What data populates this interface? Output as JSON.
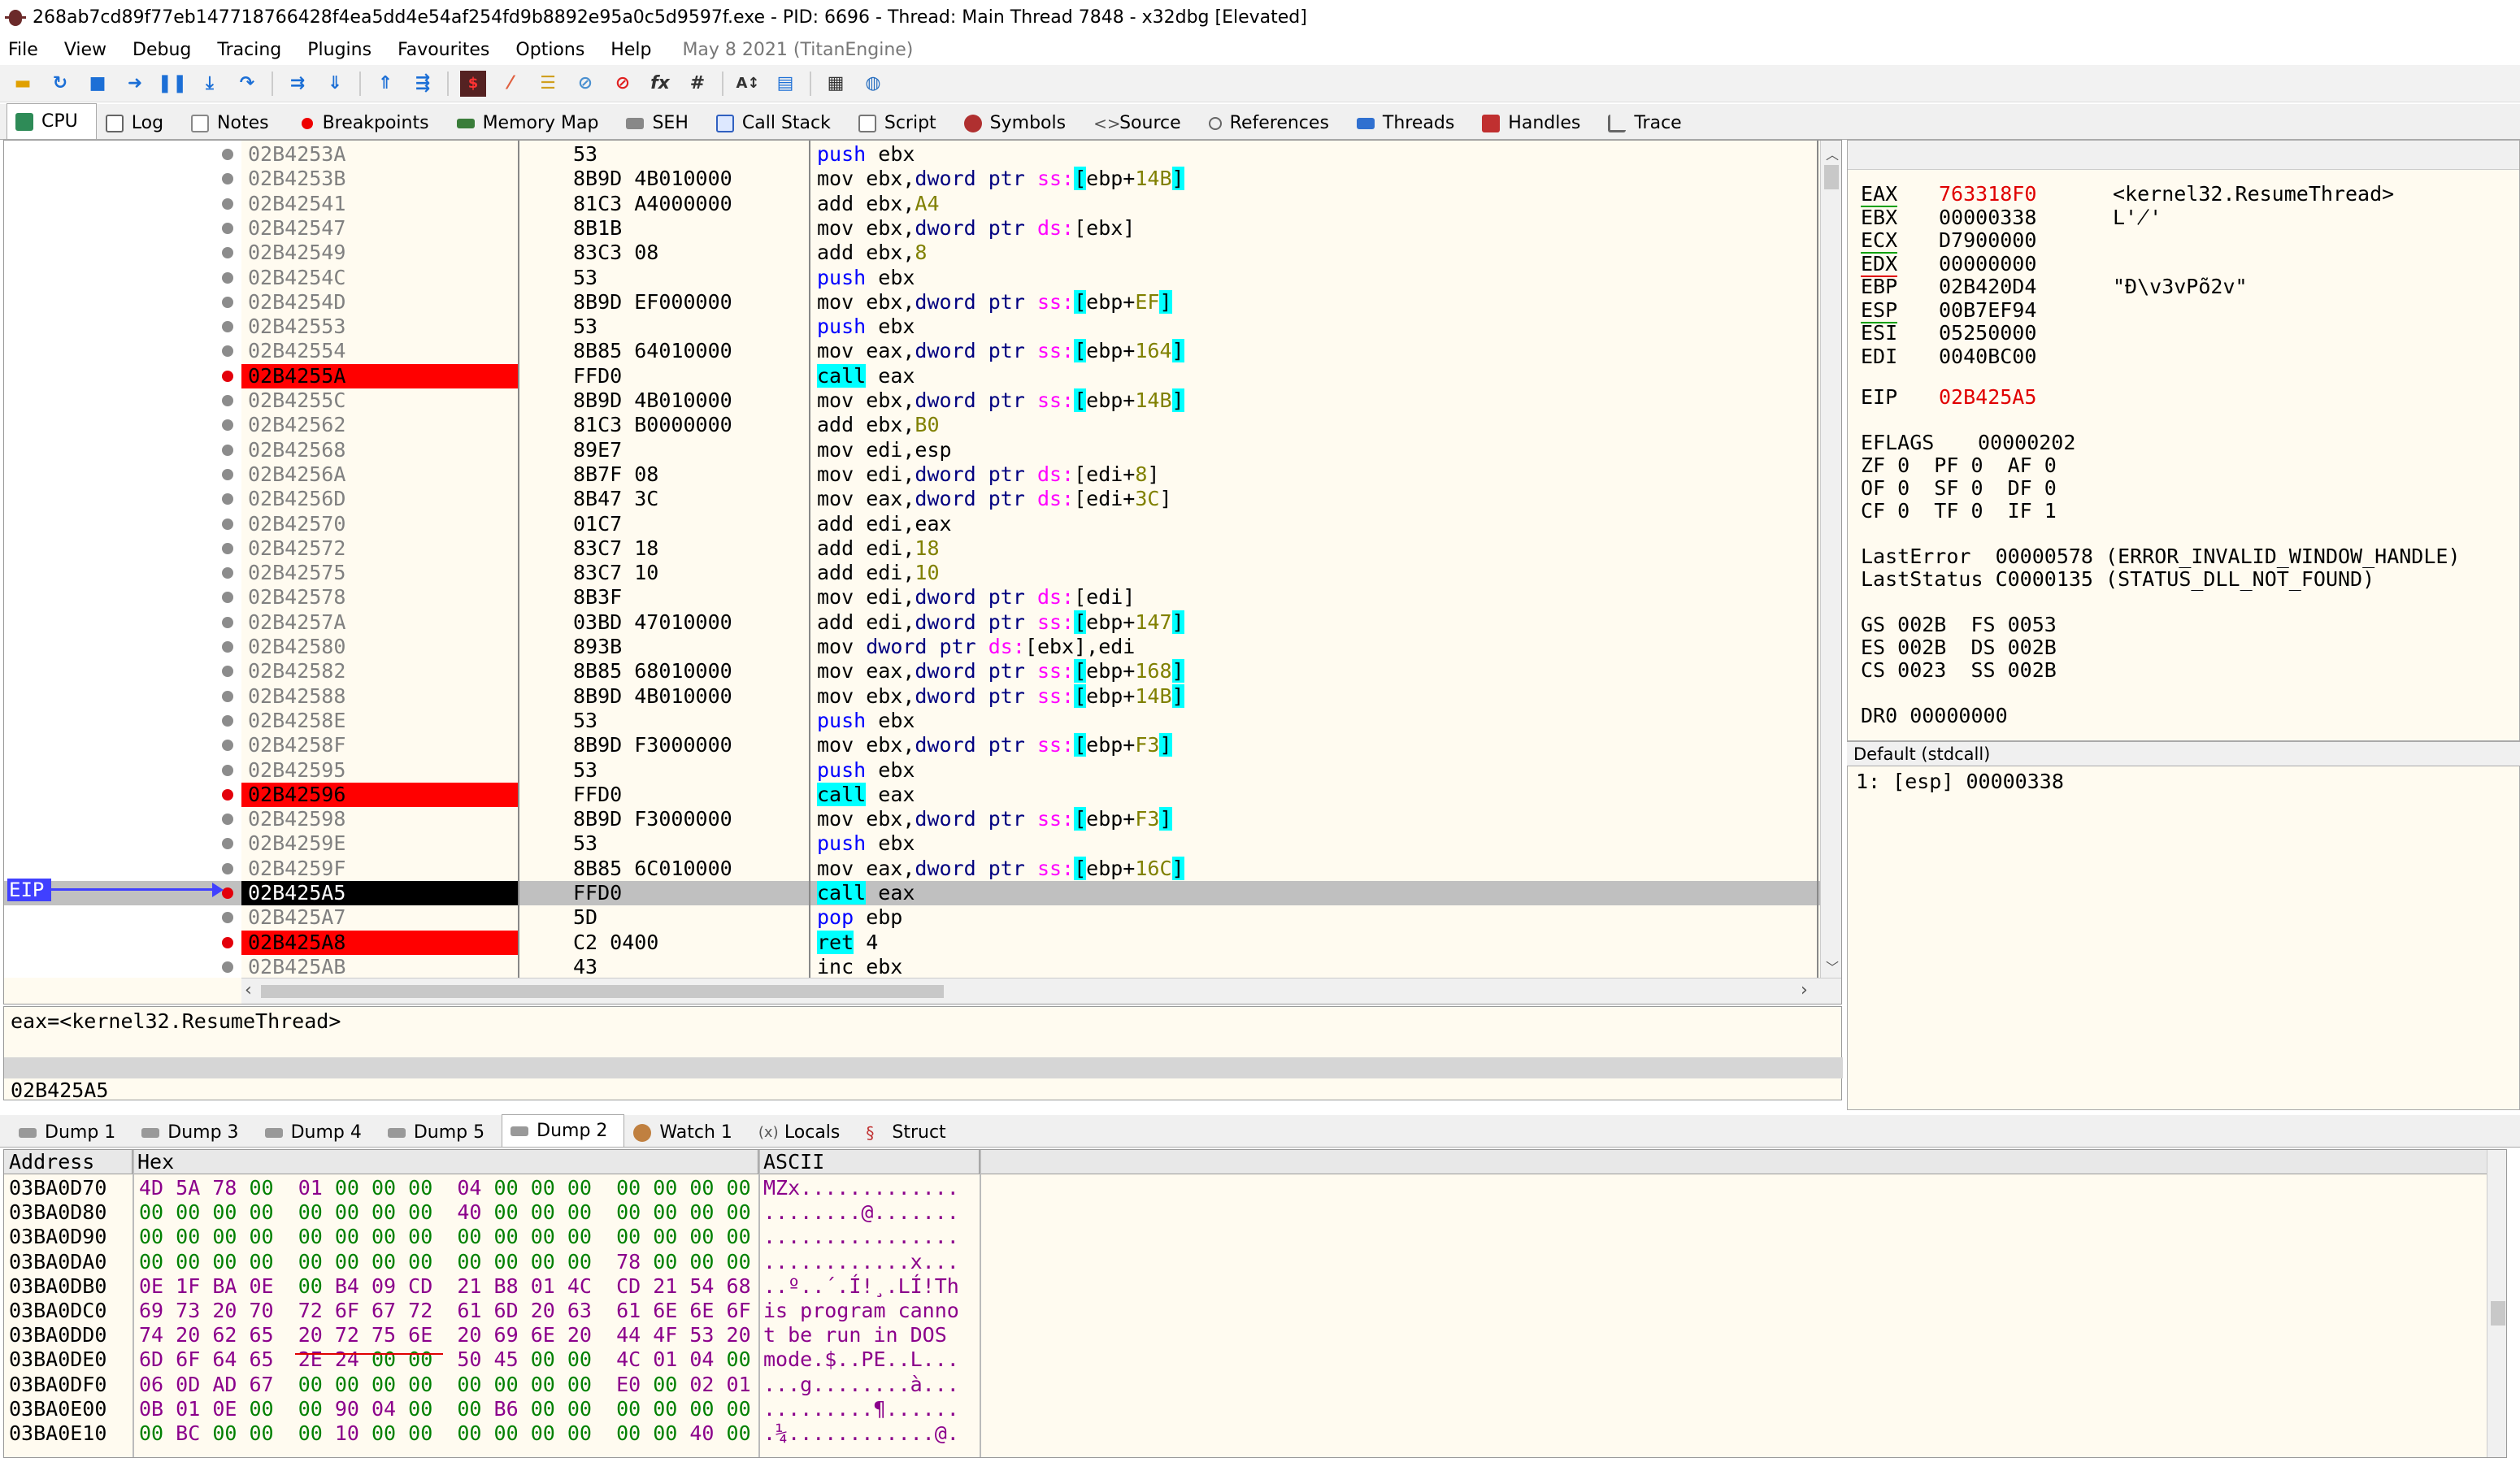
{
  "window": {
    "title": "268ab7cd89f77eb147718766428f4ea5dd4e54af254fd9b8892e95a0c5d9597f.exe - PID: 6696 - Thread: Main Thread 7848 - x32dbg [Elevated]"
  },
  "menu": {
    "items": [
      "File",
      "View",
      "Debug",
      "Tracing",
      "Plugins",
      "Favourites",
      "Options",
      "Help"
    ],
    "date": "May 8 2021 (TitanEngine)"
  },
  "toolbar": {
    "icons": [
      "open-icon",
      "restart-icon",
      "close-icon",
      "run-icon",
      "pause-icon",
      "step-into-icon",
      "step-over-icon",
      "trace-into-icon",
      "trace-over-icon",
      "execute-till-return-icon",
      "run-to-user-code-icon",
      "scylla-icon",
      "patch-icon",
      "comment-icon",
      "label-icon",
      "bookmark-icon",
      "function-icon",
      "hash-icon",
      "font-icon",
      "favourites-icon",
      "calculator-icon",
      "help-icon"
    ]
  },
  "tabs": [
    {
      "label": "CPU",
      "icon": "cpu-icon"
    },
    {
      "label": "Log",
      "icon": "log-icon"
    },
    {
      "label": "Notes",
      "icon": "notes-icon"
    },
    {
      "label": "Breakpoints",
      "icon": "breakpoint-icon"
    },
    {
      "label": "Memory Map",
      "icon": "memory-icon"
    },
    {
      "label": "SEH",
      "icon": "seh-icon"
    },
    {
      "label": "Call Stack",
      "icon": "callstack-icon"
    },
    {
      "label": "Script",
      "icon": "script-icon"
    },
    {
      "label": "Symbols",
      "icon": "symbols-icon"
    },
    {
      "label": "Source",
      "icon": "source-icon"
    },
    {
      "label": "References",
      "icon": "references-icon"
    },
    {
      "label": "Threads",
      "icon": "threads-icon"
    },
    {
      "label": "Handles",
      "icon": "handles-icon"
    },
    {
      "label": "Trace",
      "icon": "trace-icon"
    }
  ],
  "eip_label": "EIP",
  "disasm": [
    {
      "addr": "02B4253A",
      "bytes": "53",
      "ins": [
        [
          "push",
          "push"
        ],
        [
          "t",
          " ebx"
        ]
      ],
      "state": ""
    },
    {
      "addr": "02B4253B",
      "bytes": "8B9D 4B010000",
      "ins": [
        [
          "mov",
          "mov"
        ],
        [
          "t",
          " ebx,"
        ],
        [
          "ptr",
          "dword ptr "
        ],
        [
          "seg",
          "ss:"
        ],
        [
          "br",
          "["
        ],
        [
          "t",
          "ebp+"
        ],
        [
          "num",
          "14B"
        ],
        [
          "br",
          "]"
        ]
      ],
      "state": ""
    },
    {
      "addr": "02B42541",
      "bytes": "81C3 A4000000",
      "ins": [
        [
          "add",
          "add"
        ],
        [
          "t",
          " ebx,"
        ],
        [
          "num",
          "A4"
        ]
      ],
      "state": ""
    },
    {
      "addr": "02B42547",
      "bytes": "8B1B",
      "ins": [
        [
          "mov",
          "mov"
        ],
        [
          "t",
          " ebx,"
        ],
        [
          "ptr",
          "dword ptr "
        ],
        [
          "seg",
          "ds:"
        ],
        [
          "t",
          "[ebx]"
        ]
      ],
      "state": ""
    },
    {
      "addr": "02B42549",
      "bytes": "83C3 08",
      "ins": [
        [
          "add",
          "add"
        ],
        [
          "t",
          " ebx,"
        ],
        [
          "num",
          "8"
        ]
      ],
      "state": ""
    },
    {
      "addr": "02B4254C",
      "bytes": "53",
      "ins": [
        [
          "push",
          "push"
        ],
        [
          "t",
          " ebx"
        ]
      ],
      "state": ""
    },
    {
      "addr": "02B4254D",
      "bytes": "8B9D EF000000",
      "ins": [
        [
          "mov",
          "mov"
        ],
        [
          "t",
          " ebx,"
        ],
        [
          "ptr",
          "dword ptr "
        ],
        [
          "seg",
          "ss:"
        ],
        [
          "br",
          "["
        ],
        [
          "t",
          "ebp+"
        ],
        [
          "num",
          "EF"
        ],
        [
          "br",
          "]"
        ]
      ],
      "state": ""
    },
    {
      "addr": "02B42553",
      "bytes": "53",
      "ins": [
        [
          "push",
          "push"
        ],
        [
          "t",
          " ebx"
        ]
      ],
      "state": ""
    },
    {
      "addr": "02B42554",
      "bytes": "8B85 64010000",
      "ins": [
        [
          "mov",
          "mov"
        ],
        [
          "t",
          " eax,"
        ],
        [
          "ptr",
          "dword ptr "
        ],
        [
          "seg",
          "ss:"
        ],
        [
          "br",
          "["
        ],
        [
          "t",
          "ebp+"
        ],
        [
          "num",
          "164"
        ],
        [
          "br",
          "]"
        ]
      ],
      "state": ""
    },
    {
      "addr": "02B4255A",
      "bytes": "FFD0",
      "ins": [
        [
          "call",
          "call"
        ],
        [
          "t",
          " eax"
        ]
      ],
      "state": "bp"
    },
    {
      "addr": "02B4255C",
      "bytes": "8B9D 4B010000",
      "ins": [
        [
          "mov",
          "mov"
        ],
        [
          "t",
          " ebx,"
        ],
        [
          "ptr",
          "dword ptr "
        ],
        [
          "seg",
          "ss:"
        ],
        [
          "br",
          "["
        ],
        [
          "t",
          "ebp+"
        ],
        [
          "num",
          "14B"
        ],
        [
          "br",
          "]"
        ]
      ],
      "state": ""
    },
    {
      "addr": "02B42562",
      "bytes": "81C3 B0000000",
      "ins": [
        [
          "add",
          "add"
        ],
        [
          "t",
          " ebx,"
        ],
        [
          "num",
          "B0"
        ]
      ],
      "state": ""
    },
    {
      "addr": "02B42568",
      "bytes": "89E7",
      "ins": [
        [
          "mov",
          "mov"
        ],
        [
          "t",
          " edi,esp"
        ]
      ],
      "state": ""
    },
    {
      "addr": "02B4256A",
      "bytes": "8B7F 08",
      "ins": [
        [
          "mov",
          "mov"
        ],
        [
          "t",
          " edi,"
        ],
        [
          "ptr",
          "dword ptr "
        ],
        [
          "seg",
          "ds:"
        ],
        [
          "t",
          "[edi+"
        ],
        [
          "num",
          "8"
        ],
        [
          "t",
          "]"
        ]
      ],
      "state": ""
    },
    {
      "addr": "02B4256D",
      "bytes": "8B47 3C",
      "ins": [
        [
          "mov",
          "mov"
        ],
        [
          "t",
          " eax,"
        ],
        [
          "ptr",
          "dword ptr "
        ],
        [
          "seg",
          "ds:"
        ],
        [
          "t",
          "[edi+"
        ],
        [
          "num",
          "3C"
        ],
        [
          "t",
          "]"
        ]
      ],
      "state": ""
    },
    {
      "addr": "02B42570",
      "bytes": "01C7",
      "ins": [
        [
          "add",
          "add"
        ],
        [
          "t",
          " edi,eax"
        ]
      ],
      "state": ""
    },
    {
      "addr": "02B42572",
      "bytes": "83C7 18",
      "ins": [
        [
          "add",
          "add"
        ],
        [
          "t",
          " edi,"
        ],
        [
          "num",
          "18"
        ]
      ],
      "state": ""
    },
    {
      "addr": "02B42575",
      "bytes": "83C7 10",
      "ins": [
        [
          "add",
          "add"
        ],
        [
          "t",
          " edi,"
        ],
        [
          "num",
          "10"
        ]
      ],
      "state": ""
    },
    {
      "addr": "02B42578",
      "bytes": "8B3F",
      "ins": [
        [
          "mov",
          "mov"
        ],
        [
          "t",
          " edi,"
        ],
        [
          "ptr",
          "dword ptr "
        ],
        [
          "seg",
          "ds:"
        ],
        [
          "t",
          "[edi]"
        ]
      ],
      "state": ""
    },
    {
      "addr": "02B4257A",
      "bytes": "03BD 47010000",
      "ins": [
        [
          "add",
          "add"
        ],
        [
          "t",
          " edi,"
        ],
        [
          "ptr",
          "dword ptr "
        ],
        [
          "seg",
          "ss:"
        ],
        [
          "br",
          "["
        ],
        [
          "t",
          "ebp+"
        ],
        [
          "num",
          "147"
        ],
        [
          "br",
          "]"
        ]
      ],
      "state": ""
    },
    {
      "addr": "02B42580",
      "bytes": "893B",
      "ins": [
        [
          "mov",
          "mov"
        ],
        [
          "t",
          " "
        ],
        [
          "ptr",
          "dword ptr "
        ],
        [
          "seg",
          "ds:"
        ],
        [
          "t",
          "[ebx],edi"
        ]
      ],
      "state": ""
    },
    {
      "addr": "02B42582",
      "bytes": "8B85 68010000",
      "ins": [
        [
          "mov",
          "mov"
        ],
        [
          "t",
          " eax,"
        ],
        [
          "ptr",
          "dword ptr "
        ],
        [
          "seg",
          "ss:"
        ],
        [
          "br",
          "["
        ],
        [
          "t",
          "ebp+"
        ],
        [
          "num",
          "168"
        ],
        [
          "br",
          "]"
        ]
      ],
      "state": ""
    },
    {
      "addr": "02B42588",
      "bytes": "8B9D 4B010000",
      "ins": [
        [
          "mov",
          "mov"
        ],
        [
          "t",
          " ebx,"
        ],
        [
          "ptr",
          "dword ptr "
        ],
        [
          "seg",
          "ss:"
        ],
        [
          "br",
          "["
        ],
        [
          "t",
          "ebp+"
        ],
        [
          "num",
          "14B"
        ],
        [
          "br",
          "]"
        ]
      ],
      "state": ""
    },
    {
      "addr": "02B4258E",
      "bytes": "53",
      "ins": [
        [
          "push",
          "push"
        ],
        [
          "t",
          " ebx"
        ]
      ],
      "state": ""
    },
    {
      "addr": "02B4258F",
      "bytes": "8B9D F3000000",
      "ins": [
        [
          "mov",
          "mov"
        ],
        [
          "t",
          " ebx,"
        ],
        [
          "ptr",
          "dword ptr "
        ],
        [
          "seg",
          "ss:"
        ],
        [
          "br",
          "["
        ],
        [
          "t",
          "ebp+"
        ],
        [
          "num",
          "F3"
        ],
        [
          "br",
          "]"
        ]
      ],
      "state": ""
    },
    {
      "addr": "02B42595",
      "bytes": "53",
      "ins": [
        [
          "push",
          "push"
        ],
        [
          "t",
          " ebx"
        ]
      ],
      "state": ""
    },
    {
      "addr": "02B42596",
      "bytes": "FFD0",
      "ins": [
        [
          "call",
          "call"
        ],
        [
          "t",
          " eax"
        ]
      ],
      "state": "bp"
    },
    {
      "addr": "02B42598",
      "bytes": "8B9D F3000000",
      "ins": [
        [
          "mov",
          "mov"
        ],
        [
          "t",
          " ebx,"
        ],
        [
          "ptr",
          "dword ptr "
        ],
        [
          "seg",
          "ss:"
        ],
        [
          "br",
          "["
        ],
        [
          "t",
          "ebp+"
        ],
        [
          "num",
          "F3"
        ],
        [
          "br",
          "]"
        ]
      ],
      "state": ""
    },
    {
      "addr": "02B4259E",
      "bytes": "53",
      "ins": [
        [
          "push",
          "push"
        ],
        [
          "t",
          " ebx"
        ]
      ],
      "state": ""
    },
    {
      "addr": "02B4259F",
      "bytes": "8B85 6C010000",
      "ins": [
        [
          "mov",
          "mov"
        ],
        [
          "t",
          " eax,"
        ],
        [
          "ptr",
          "dword ptr "
        ],
        [
          "seg",
          "ss:"
        ],
        [
          "br",
          "["
        ],
        [
          "t",
          "ebp+"
        ],
        [
          "num",
          "16C"
        ],
        [
          "br",
          "]"
        ]
      ],
      "state": ""
    },
    {
      "addr": "02B425A5",
      "bytes": "FFD0",
      "ins": [
        [
          "call",
          "call"
        ],
        [
          "t",
          " eax"
        ]
      ],
      "state": "eip"
    },
    {
      "addr": "02B425A7",
      "bytes": "5D",
      "ins": [
        [
          "pop",
          "pop"
        ],
        [
          "t",
          " ebp"
        ]
      ],
      "state": ""
    },
    {
      "addr": "02B425A8",
      "bytes": "C2 0400",
      "ins": [
        [
          "call",
          "ret"
        ],
        [
          "t",
          " 4"
        ]
      ],
      "state": "bp"
    },
    {
      "addr": "02B425AB",
      "bytes": "43",
      "ins": [
        [
          "inc",
          "inc"
        ],
        [
          "t",
          " ebx"
        ]
      ],
      "state": ""
    }
  ],
  "info": {
    "line1": "eax=<kernel32.ResumeThread>",
    "line2": "02B425A5"
  },
  "registers": {
    "gp": [
      {
        "name": "EAX",
        "value": "763318F0",
        "comment": "<kernel32.ResumeThread>",
        "changed": true
      },
      {
        "name": "EBX",
        "value": "00000338",
        "comment": "L'̸'",
        "changed": false
      },
      {
        "name": "ECX",
        "value": "D7900000",
        "comment": "",
        "changed": false
      },
      {
        "name": "EDX",
        "value": "00000000",
        "comment": "",
        "changed": false
      },
      {
        "name": "EBP",
        "value": "02B420D4",
        "comment": "\"Ð\\v3vPõ2v\"",
        "changed": false
      },
      {
        "name": "ESP",
        "value": "00B7EF94",
        "comment": "",
        "changed": false
      },
      {
        "name": "ESI",
        "value": "05250000",
        "comment": "",
        "changed": false
      },
      {
        "name": "EDI",
        "value": "0040BC00",
        "comment": "",
        "changed": false
      }
    ],
    "eip": {
      "name": "EIP",
      "value": "02B425A5"
    },
    "eflags": {
      "name": "EFLAGS",
      "value": "00000202"
    },
    "flags": [
      "ZF 0  PF 0  AF 0",
      "OF 0  SF 0  DF 0",
      "CF 0  TF 0  IF 1"
    ],
    "lasterror": "LastError  00000578 (ERROR_INVALID_WINDOW_HANDLE)",
    "laststatus": "LastStatus C0000135 (STATUS_DLL_NOT_FOUND)",
    "segs": [
      "GS 002B  FS 0053",
      "ES 002B  DS 002B",
      "CS 0023  SS 002B"
    ],
    "dr0": "DR0 00000000"
  },
  "stack": {
    "header": "Default (stdcall)",
    "line": "1: [esp] 00000338"
  },
  "dumptabs": [
    {
      "label": "Dump 1"
    },
    {
      "label": "Dump 3"
    },
    {
      "label": "Dump 4"
    },
    {
      "label": "Dump 5"
    },
    {
      "label": "Dump 2"
    },
    {
      "label": "Watch 1"
    },
    {
      "label": "Locals"
    },
    {
      "label": "Struct"
    }
  ],
  "dump": {
    "headers": [
      "Address",
      "Hex",
      "ASCII"
    ],
    "rows": [
      {
        "addr": "03BA0D70",
        "hex": [
          "4D",
          "5A",
          "78",
          "00",
          "01",
          "00",
          "00",
          "00",
          "04",
          "00",
          "00",
          "00",
          "00",
          "00",
          "00",
          "00"
        ],
        "ascii": "MZx............."
      },
      {
        "addr": "03BA0D80",
        "hex": [
          "00",
          "00",
          "00",
          "00",
          "00",
          "00",
          "00",
          "00",
          "40",
          "00",
          "00",
          "00",
          "00",
          "00",
          "00",
          "00"
        ],
        "ascii": "........@......."
      },
      {
        "addr": "03BA0D90",
        "hex": [
          "00",
          "00",
          "00",
          "00",
          "00",
          "00",
          "00",
          "00",
          "00",
          "00",
          "00",
          "00",
          "00",
          "00",
          "00",
          "00"
        ],
        "ascii": "................"
      },
      {
        "addr": "03BA0DA0",
        "hex": [
          "00",
          "00",
          "00",
          "00",
          "00",
          "00",
          "00",
          "00",
          "00",
          "00",
          "00",
          "00",
          "78",
          "00",
          "00",
          "00"
        ],
        "ascii": "............x..."
      },
      {
        "addr": "03BA0DB0",
        "hex": [
          "0E",
          "1F",
          "BA",
          "0E",
          "00",
          "B4",
          "09",
          "CD",
          "21",
          "B8",
          "01",
          "4C",
          "CD",
          "21",
          "54",
          "68"
        ],
        "ascii": "..º..´.Í!¸.LÍ!Th"
      },
      {
        "addr": "03BA0DC0",
        "hex": [
          "69",
          "73",
          "20",
          "70",
          "72",
          "6F",
          "67",
          "72",
          "61",
          "6D",
          "20",
          "63",
          "61",
          "6E",
          "6E",
          "6F"
        ],
        "ascii": "is program canno"
      },
      {
        "addr": "03BA0DD0",
        "hex": [
          "74",
          "20",
          "62",
          "65",
          "20",
          "72",
          "75",
          "6E",
          "20",
          "69",
          "6E",
          "20",
          "44",
          "4F",
          "53",
          "20"
        ],
        "ascii": "t be run in DOS "
      },
      {
        "addr": "03BA0DE0",
        "hex": [
          "6D",
          "6F",
          "64",
          "65",
          "2E",
          "24",
          "00",
          "00",
          "50",
          "45",
          "00",
          "00",
          "4C",
          "01",
          "04",
          "00"
        ],
        "ascii": "mode.$..PE..L..."
      },
      {
        "addr": "03BA0DF0",
        "hex": [
          "06",
          "0D",
          "AD",
          "67",
          "00",
          "00",
          "00",
          "00",
          "00",
          "00",
          "00",
          "00",
          "E0",
          "00",
          "02",
          "01"
        ],
        "ascii": "...g........à..."
      },
      {
        "addr": "03BA0E00",
        "hex": [
          "0B",
          "01",
          "0E",
          "00",
          "00",
          "90",
          "04",
          "00",
          "00",
          "B6",
          "00",
          "00",
          "00",
          "00",
          "00",
          "00"
        ],
        "ascii": ".........¶......"
      },
      {
        "addr": "03BA0E10",
        "hex": [
          "00",
          "BC",
          "00",
          "00",
          "00",
          "10",
          "00",
          "00",
          "00",
          "00",
          "00",
          "00",
          "00",
          "00",
          "40",
          "00"
        ],
        "ascii": ".¼............@."
      }
    ]
  }
}
